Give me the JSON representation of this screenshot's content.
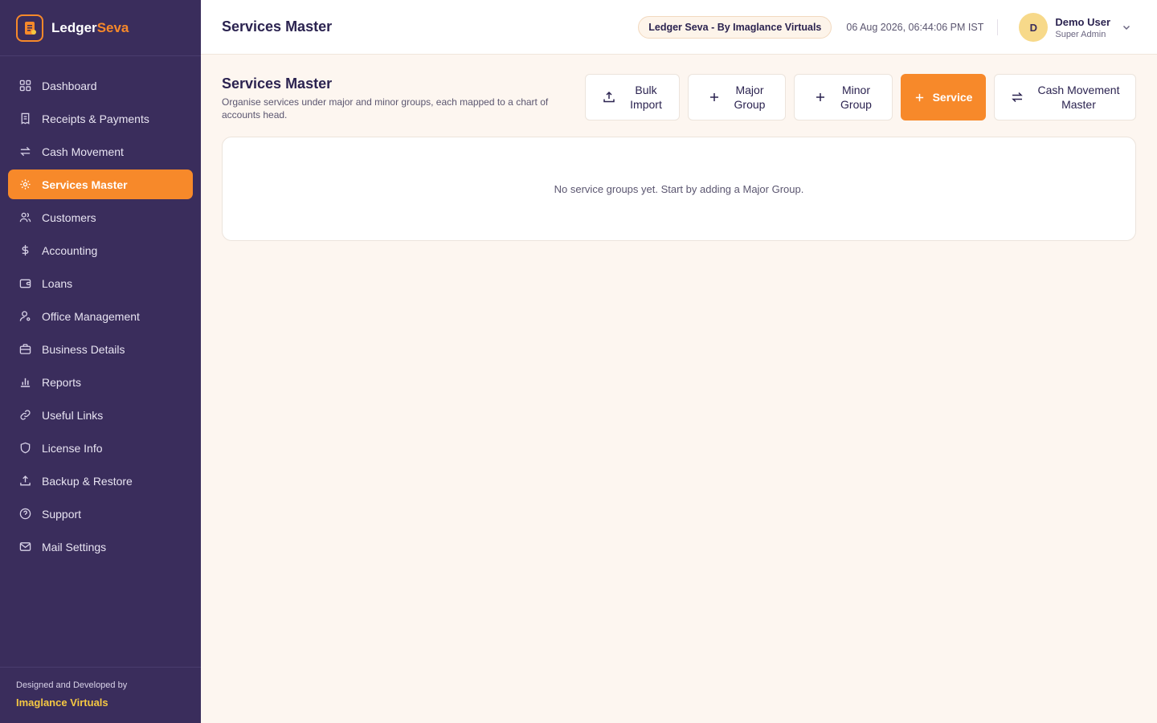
{
  "brand": {
    "name_part1": "Ledger",
    "name_part2": "Seva",
    "accent_color": "#f7892a"
  },
  "sidebar": {
    "items": [
      {
        "label": "Dashboard",
        "icon": "grid-icon",
        "active": false
      },
      {
        "label": "Receipts & Payments",
        "icon": "receipt-icon",
        "active": false
      },
      {
        "label": "Cash Movement",
        "icon": "arrows-swap-icon",
        "active": false
      },
      {
        "label": "Services Master",
        "icon": "gear-icon",
        "active": true
      },
      {
        "label": "Customers",
        "icon": "users-icon",
        "active": false
      },
      {
        "label": "Accounting",
        "icon": "dollar-icon",
        "active": false
      },
      {
        "label": "Loans",
        "icon": "wallet-icon",
        "active": false
      },
      {
        "label": "Office Management",
        "icon": "user-cog-icon",
        "active": false
      },
      {
        "label": "Business Details",
        "icon": "briefcase-icon",
        "active": false
      },
      {
        "label": "Reports",
        "icon": "bar-chart-icon",
        "active": false
      },
      {
        "label": "Useful Links",
        "icon": "link-icon",
        "active": false
      },
      {
        "label": "License Info",
        "icon": "shield-icon",
        "active": false
      },
      {
        "label": "Backup & Restore",
        "icon": "upload-icon",
        "active": false
      },
      {
        "label": "Support",
        "icon": "help-circle-icon",
        "active": false
      },
      {
        "label": "Mail Settings",
        "icon": "mail-icon",
        "active": false
      }
    ],
    "footer_caption": "Designed and Developed by",
    "footer_company": "Imaglance Virtuals"
  },
  "header": {
    "title": "Services Master",
    "org_badge": "Ledger Seva - By Imaglance Virtuals",
    "datetime": "06 Aug 2026, 06:44:06 PM IST",
    "user": {
      "initial": "D",
      "name": "Demo User",
      "role": "Super Admin"
    }
  },
  "main": {
    "title": "Services Master",
    "subtitle": "Organise services under major and minor groups, each mapped to a chart of accounts head.",
    "actions": {
      "bulk_import": {
        "line1": "Bulk",
        "line2": "Import"
      },
      "major_group": {
        "line1": "Major",
        "line2": "Group"
      },
      "minor_group": {
        "line1": "Minor",
        "line2": "Group"
      },
      "service": {
        "label": "Service"
      },
      "cash_movement_master": {
        "line1": "Cash Movement",
        "line2": "Master"
      }
    },
    "empty_message": "No service groups yet. Start by adding a Major Group."
  },
  "colors": {
    "sidebar_bg": "#3a2d5c",
    "accent": "#f7892a",
    "page_bg": "#fdf6f0",
    "footer_company": "#f5c842"
  }
}
